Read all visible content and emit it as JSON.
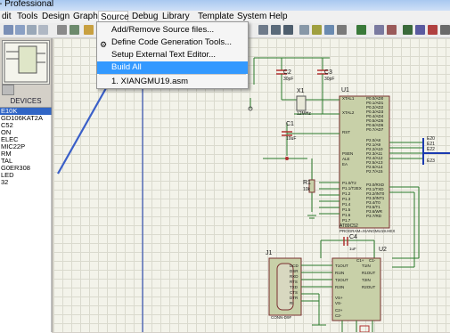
{
  "title": "- Professional",
  "menu": {
    "items": [
      "dit",
      "Tools",
      "Design",
      "Graph",
      "Source",
      "Debug",
      "Library",
      "Template",
      "System",
      "Help"
    ]
  },
  "source_menu": {
    "items": [
      {
        "label": "Add/Remove Source files..."
      },
      {
        "label": "Define Code Generation Tools..."
      },
      {
        "label": "Setup External Text Editor..."
      },
      {
        "label": "Build All"
      },
      {
        "label": "1. XIANGMU19.asm"
      }
    ]
  },
  "devices": {
    "header": "DEVICES",
    "items": [
      "E10K",
      "GD106KAT2A",
      "C52",
      "ON",
      "ELEC",
      "MIC22P",
      "RM",
      "TAL",
      "G0ER308",
      "LED",
      "32"
    ],
    "selected_index": 0
  },
  "schematic": {
    "labels": {
      "c2": "C2",
      "c2v": "30pF",
      "c3": "C3",
      "c3v": "30pF",
      "x1": "X1",
      "x1v": "12MHz",
      "c1": "C1",
      "c1v": "10uF",
      "r1": "R1",
      "r1v": "10k",
      "u1": "U1",
      "u1part": "AT89C52",
      "u1foot": "PROGRAM=XIANGMU19.HEX",
      "c4": "C4",
      "u2": "U2",
      "j1": "J1",
      "j1foot": "CONN-D9F",
      "c4v": "1uF",
      "xtal1": "XTAL1",
      "xtal2": "XTAL2",
      "rst": "RST",
      "psen": "PSEN",
      "ale": "ALE",
      "ea": "EA",
      "u1left": [
        "P1.0/T2",
        "P1.1/T2EX",
        "P1.2",
        "P1.3",
        "P1.4",
        "P1.5",
        "P1.6",
        "P1.7"
      ],
      "u1right": [
        "P0.0/AD0",
        "P0.1/AD1",
        "P0.2/AD2",
        "P0.3/AD3",
        "P0.4/AD4",
        "P0.5/AD5",
        "P0.6/AD6",
        "P0.7/AD7"
      ],
      "u1right2": [
        "P2.0/A8",
        "P2.1/A9",
        "P2.2/A10",
        "P2.3/A11",
        "P2.4/A12",
        "P2.5/A13",
        "P2.6/A14",
        "P2.7/A15"
      ],
      "u1right3": [
        "P3.0/RXD",
        "P3.1/TXD",
        "P3.2/INT0",
        "P3.3/INT1",
        "P3.4/T0",
        "P3.5/T1",
        "P3.6/WR",
        "P3.7/RD"
      ],
      "j1pins": [
        "DCD",
        "DSR",
        "RXD",
        "RTS",
        "TXD",
        "CTS",
        "DTR",
        "RI"
      ],
      "u2left": [
        "T1OUT",
        "R1IN",
        "T2OUT",
        "R2IN"
      ],
      "u2right": [
        "T1IN",
        "R1OUT",
        "T2IN",
        "R2OUT"
      ],
      "u2bottom": [
        "VS+",
        "VS-",
        "C2+",
        "C2-"
      ],
      "u2top": [
        "C1+",
        "C1-"
      ],
      "netright": [
        "E20",
        "E21",
        "E22",
        "E23"
      ]
    }
  }
}
